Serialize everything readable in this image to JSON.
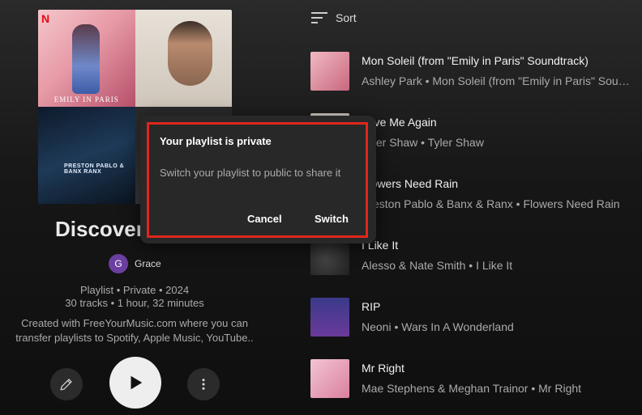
{
  "playlist": {
    "title": "Discover",
    "owner_initial": "G",
    "owner_name": "Grace",
    "meta_line1": "Playlist • Private • 2024",
    "meta_line2": "30 tracks • 1 hour, 32 minutes",
    "description_line1": "Created with FreeYourMusic.com where you can",
    "description_line2": "transfer playlists to Spotify, Apple Music, YouTube..",
    "artwork_caption": "EMILY IN PARIS",
    "artwork_badge": "N",
    "artwork_label2": "PRESTON PABLO & BANX RANX"
  },
  "controls": {
    "edit_icon": "pencil-icon",
    "play_icon": "play-icon",
    "more_icon": "more-vert-icon"
  },
  "sort": {
    "label": "Sort",
    "icon": "sort-icon"
  },
  "tracks": [
    {
      "title": "Mon Soleil (from \"Emily in Paris\" Soundtrack)",
      "subtitle": "Ashley Park • Mon Soleil (from \"Emily in Paris\" Soundtrack)",
      "thumb_color": "#d98a98"
    },
    {
      "title": "Love Me Again",
      "subtitle": "Tyler Shaw • Tyler Shaw",
      "thumb_color": "#c9bfb2"
    },
    {
      "title": "Flowers Need Rain",
      "subtitle": "Preston Pablo & Banx & Ranx • Flowers Need Rain",
      "thumb_color": "#1c3350"
    },
    {
      "title": "I Like It",
      "subtitle": "Alesso & Nate Smith • I Like It",
      "thumb_color": "#2b2b2b"
    },
    {
      "title": "RIP",
      "subtitle": "Neoni • Wars In A Wonderland",
      "thumb_color": "#2a2a6a"
    },
    {
      "title": "Mr Right",
      "subtitle": "Mae Stephens & Meghan Trainor • Mr Right",
      "thumb_color": "#e8a8bd"
    }
  ],
  "dialog": {
    "title": "Your playlist is private",
    "body": "Switch your playlist to public to share it",
    "cancel_label": "Cancel",
    "switch_label": "Switch",
    "highlight_color": "#e0261c"
  }
}
